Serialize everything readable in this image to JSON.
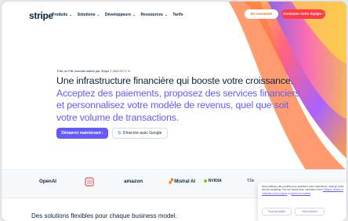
{
  "header": {
    "logo": "stripe",
    "menu": [
      "Produits",
      "Solutions",
      "Développeurs",
      "Ressources",
      "Tarifs"
    ],
    "login": "Se connecter",
    "contact": "Contacter notre équipe"
  },
  "hero": {
    "kicker": "Part du PIB mondial traitée par Stripe",
    "kicker_amount": "1,35410271 %",
    "title_dark": "Une infrastructure financière qui booste votre croissance.",
    "title_light": "Acceptez des paiements, proposez des services financiers et personnalisez votre modèle de revenus, quel que soit votre volume de transactions.",
    "cta": "Démarrer maintenant",
    "google": "S'inscrire avec Google"
  },
  "logos": [
    "OpenAI",
    "Clarins",
    "amazon",
    "Mistral AI",
    "NVIDIA",
    "Tile"
  ],
  "section": {
    "title": "Des solutions flexibles pour chaque business model."
  },
  "cookie": {
    "text_1": "Nous utilisons des cookies pour améliorer votre expérience, ainsi qu'à des fins de marketing. Pour en savoir plus, consultez notre",
    "policy_link": "Politique relative à l'utilisation des cookies",
    "text_2": "ou",
    "prefs_link": "gérez les cookies",
    "accept": "Tout accepter",
    "refuse": "Tout refuser"
  },
  "colors": {
    "brand": "#635bff",
    "navy": "#0a2540",
    "orange": "#e1702a",
    "contact_button": "#ff3b4a"
  }
}
